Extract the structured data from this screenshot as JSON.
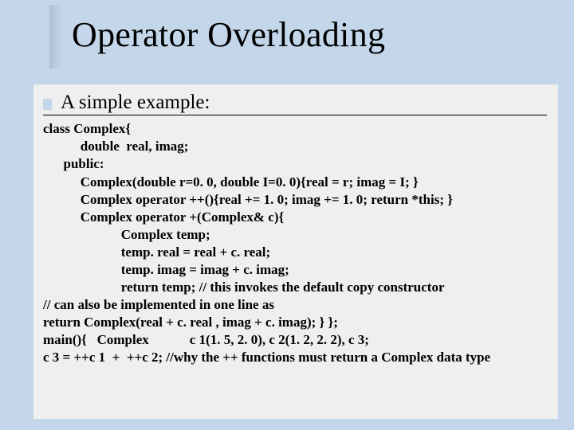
{
  "slide": {
    "title": "Operator Overloading",
    "subheading": "A simple example:",
    "code_lines": [
      "class Complex{",
      "           double  real, imag;",
      "      public:",
      "           Complex(double r=0. 0, double I=0. 0){real = r; imag = I; }",
      "           Complex operator ++(){real += 1. 0; imag += 1. 0; return *this; }",
      "           Complex operator +(Complex& c){",
      "                       Complex temp;",
      "                       temp. real = real + c. real;",
      "                       temp. imag = imag + c. imag;",
      "                       return temp; // this invokes the default copy constructor",
      "// can also be implemented in one line as",
      "return Complex(real + c. real , imag + c. imag); } };",
      "main(){   Complex            c 1(1. 5, 2. 0), c 2(1. 2, 2. 2), c 3;",
      "c 3 = ++c 1  +  ++c 2; //why the ++ functions must return a Complex data type"
    ]
  }
}
